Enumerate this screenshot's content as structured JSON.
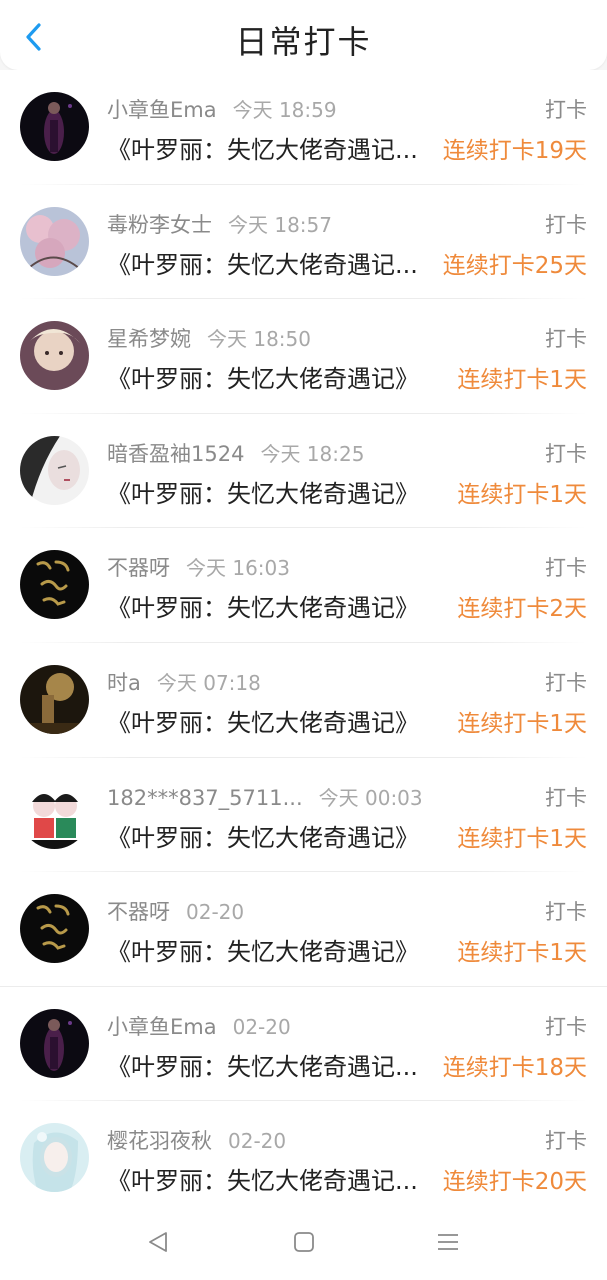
{
  "header": {
    "title": "日常打卡"
  },
  "icons": {
    "back": "chevron-left-icon",
    "nav_back": "triangle-back-icon",
    "nav_home": "square-home-icon",
    "nav_menu": "menu-lines-icon"
  },
  "colors": {
    "accent_blue": "#1e9bf0",
    "streak_orange": "#ef8a3b",
    "meta_gray": "#8a8a8a"
  },
  "items": [
    {
      "user": "小章鱼Ema",
      "time": "今天 18:59",
      "tag": "打卡",
      "book": "《叶罗丽：失忆大佬奇遇记...",
      "streak": "连续打卡19天"
    },
    {
      "user": "毒粉李女士",
      "time": "今天 18:57",
      "tag": "打卡",
      "book": "《叶罗丽：失忆大佬奇遇记...",
      "streak": "连续打卡25天"
    },
    {
      "user": "星希梦婉",
      "time": "今天 18:50",
      "tag": "打卡",
      "book": "《叶罗丽：失忆大佬奇遇记》",
      "streak": "连续打卡1天"
    },
    {
      "user": "暗香盈袖1524",
      "time": "今天 18:25",
      "tag": "打卡",
      "book": "《叶罗丽：失忆大佬奇遇记》",
      "streak": "连续打卡1天"
    },
    {
      "user": "不器呀",
      "time": "今天 16:03",
      "tag": "打卡",
      "book": "《叶罗丽：失忆大佬奇遇记》",
      "streak": "连续打卡2天"
    },
    {
      "user": "时a",
      "time": "今天 07:18",
      "tag": "打卡",
      "book": "《叶罗丽：失忆大佬奇遇记》",
      "streak": "连续打卡1天"
    },
    {
      "user": "182***837_5711...",
      "time": "今天 00:03",
      "tag": "打卡",
      "book": "《叶罗丽：失忆大佬奇遇记》",
      "streak": "连续打卡1天"
    },
    {
      "user": "不器呀",
      "time": "02-20",
      "tag": "打卡",
      "book": "《叶罗丽：失忆大佬奇遇记》",
      "streak": "连续打卡1天"
    },
    {
      "user": "小章鱼Ema",
      "time": "02-20",
      "tag": "打卡",
      "book": "《叶罗丽：失忆大佬奇遇记...",
      "streak": "连续打卡18天"
    },
    {
      "user": "樱花羽夜秋",
      "time": "02-20",
      "tag": "打卡",
      "book": "《叶罗丽：失忆大佬奇遇记...",
      "streak": "连续打卡20天"
    }
  ]
}
